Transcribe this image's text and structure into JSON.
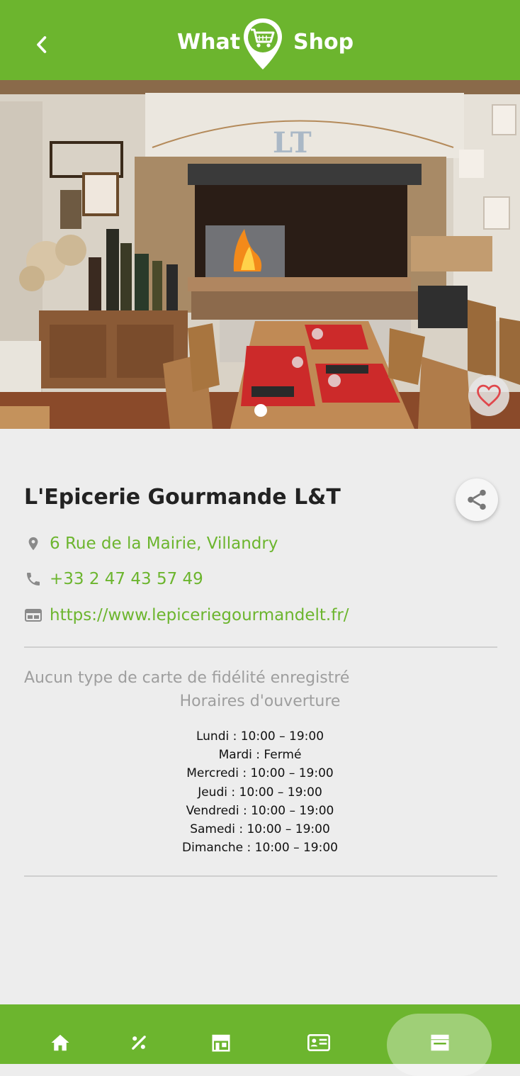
{
  "header": {
    "logo_left": "What",
    "logo_right": "Shop",
    "back_icon": "chevron-left-icon"
  },
  "gallery": {
    "image_subject": "restaurant interior with fireplace",
    "photo_sign": "LT",
    "favorite_icon": "heart-outline-icon"
  },
  "shop": {
    "name": "L'Epicerie Gourmande L&T",
    "address": "6 Rue de la Mairie, Villandry",
    "phone": "+33 2 47 43 57 49",
    "website": "https://www.lepiceriegourmandelt.fr/",
    "loyalty": "Aucun type de carte de fidélité enregistré"
  },
  "hours": {
    "title": "Horaires d'ouverture",
    "days": [
      "Lundi : 10:00 – 19:00",
      "Mardi : Fermé",
      "Mercredi : 10:00 – 19:00",
      "Jeudi : 10:00 – 19:00",
      "Vendredi : 10:00 – 19:00",
      "Samedi : 10:00 – 19:00",
      "Dimanche : 10:00 – 19:00"
    ]
  },
  "nav": {
    "items": [
      "home-icon",
      "percent-icon",
      "store-icon",
      "card-icon",
      "shop-icon"
    ],
    "active": "shop-icon"
  },
  "colors": {
    "brand_green": "#6cb52e",
    "background": "#ededed",
    "muted_text": "#9e9e9e"
  }
}
